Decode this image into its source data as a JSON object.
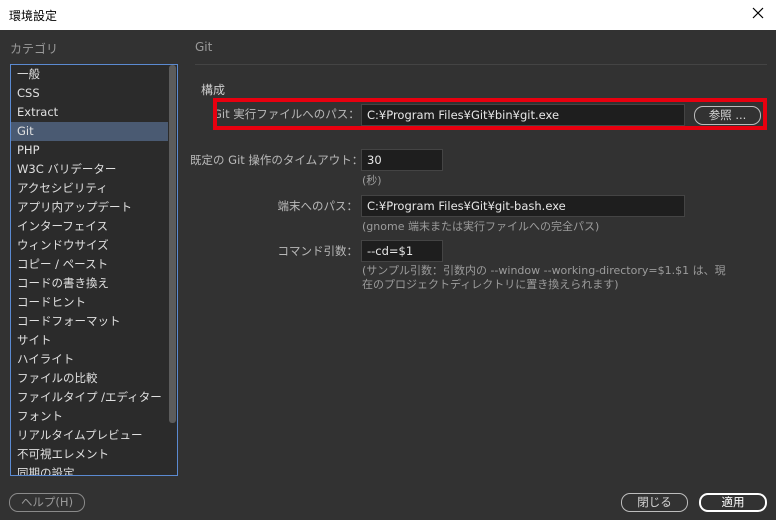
{
  "window": {
    "title": "環境設定"
  },
  "sidebar": {
    "heading": "カテゴリ",
    "items": [
      {
        "label": "一般"
      },
      {
        "label": "CSS"
      },
      {
        "label": "Extract"
      },
      {
        "label": "Git",
        "selected": true
      },
      {
        "label": "PHP"
      },
      {
        "label": "W3C バリデーター"
      },
      {
        "label": "アクセシビリティ"
      },
      {
        "label": "アプリ内アップデート"
      },
      {
        "label": "インターフェイス"
      },
      {
        "label": "ウィンドウサイズ"
      },
      {
        "label": "コピー / ペースト"
      },
      {
        "label": "コードの書き換え"
      },
      {
        "label": "コードヒント"
      },
      {
        "label": "コードフォーマット"
      },
      {
        "label": "サイト"
      },
      {
        "label": "ハイライト"
      },
      {
        "label": "ファイルの比較"
      },
      {
        "label": "ファイルタイプ /エディター"
      },
      {
        "label": "フォント"
      },
      {
        "label": "リアルタイムプレビュー"
      },
      {
        "label": "不可視エレメント"
      },
      {
        "label": "同期の設定"
      }
    ]
  },
  "main": {
    "heading": "Git",
    "section": "構成",
    "git_path": {
      "label": "Git 実行ファイルへのパス：",
      "value": "C:¥Program Files¥Git¥bin¥git.exe",
      "browse_label": "参照 ..."
    },
    "timeout": {
      "label": "既定の Git 操作のタイムアウト：",
      "value": "30",
      "hint": "(秒)"
    },
    "terminal": {
      "label": "端末へのパス：",
      "value": "C:¥Program Files¥Git¥git-bash.exe",
      "hint": "(gnome 端末または実行ファイルへの完全パス)"
    },
    "command_args": {
      "label": "コマンド引数：",
      "value": "--cd=$1",
      "hint_line1": "(サンプル引数：引数内の --window --working-directory=$1.$1 は、現",
      "hint_line2": "在のプロジェクトディレクトリに置き換えられます)"
    }
  },
  "footer": {
    "help_label": "ヘルプ(H)",
    "close_label": "閉じる",
    "apply_label": "適用"
  },
  "colors": {
    "highlight": "#e8000f",
    "selection": "#4a5a72",
    "list_border": "#5b8ad1"
  },
  "icons": {
    "close": "close-icon"
  }
}
